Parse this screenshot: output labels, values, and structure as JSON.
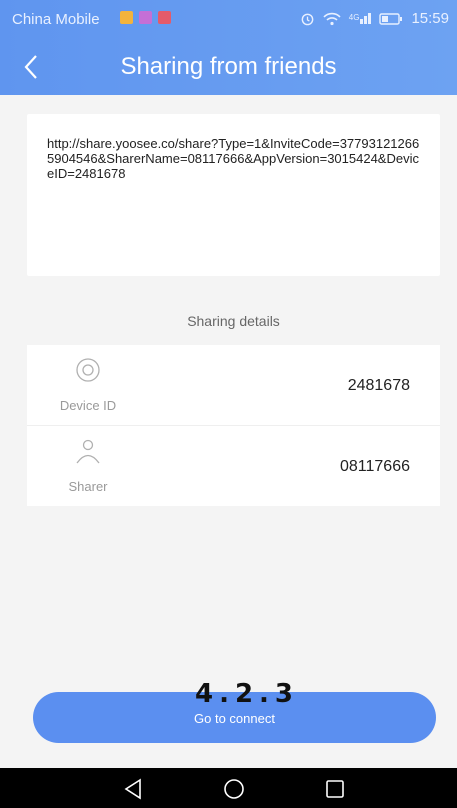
{
  "status_bar": {
    "carrier": "China Mobile",
    "network": "4G",
    "time": "15:59"
  },
  "header": {
    "title": "Sharing from friends"
  },
  "share_link": {
    "text": "http://share.yoosee.co/share?Type=1&InviteCode=377931212665904546&SharerName=08117666&AppVersion=3015424&DeviceID=2481678"
  },
  "details": {
    "section_label": "Sharing details",
    "rows": [
      {
        "label": "Device ID",
        "value": "2481678",
        "icon": "camera-icon"
      },
      {
        "label": "Sharer",
        "value": "08117666",
        "icon": "person-icon"
      }
    ]
  },
  "connect": {
    "label": "Go to connect"
  },
  "overlay": {
    "version": "4.2.3"
  },
  "colors": {
    "header": "#6a9ff2",
    "button": "#5b8ff0",
    "background": "#f4f4f4"
  }
}
